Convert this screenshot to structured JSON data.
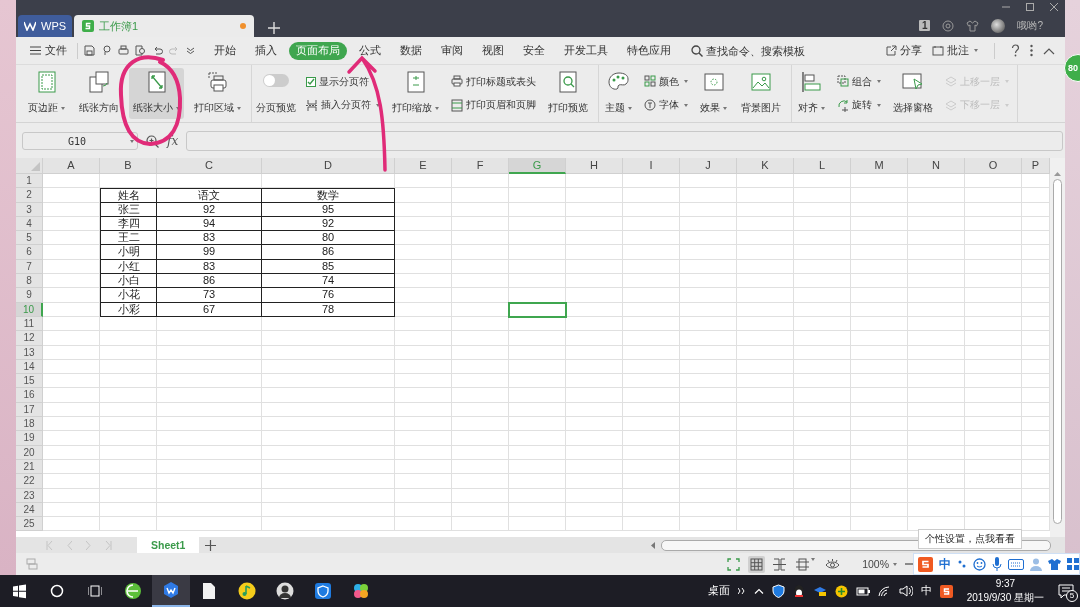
{
  "title_bar": {
    "tabs": [
      {
        "kind": "home",
        "label": "WPS",
        "selected": false
      },
      {
        "kind": "document",
        "label": "工作簿1",
        "selected": true,
        "unsaved": true
      }
    ],
    "account_badge": "1",
    "user_name": "哦哟?"
  },
  "menu": {
    "file": "文件",
    "tabs": [
      {
        "label": "开始",
        "selected": false
      },
      {
        "label": "插入",
        "selected": false
      },
      {
        "label": "页面布局",
        "selected": true
      },
      {
        "label": "公式",
        "selected": false
      },
      {
        "label": "数据",
        "selected": false
      },
      {
        "label": "审阅",
        "selected": false
      },
      {
        "label": "视图",
        "selected": false
      },
      {
        "label": "安全",
        "selected": false
      },
      {
        "label": "开发工具",
        "selected": false
      },
      {
        "label": "特色应用",
        "selected": false
      }
    ],
    "search_placeholder": "查找命令、搜索模板",
    "share": "分享",
    "comment": "批注"
  },
  "ribbon": [
    {
      "items": [
        {
          "kind": "large",
          "label": "页边距",
          "dropdown": true,
          "highlighted": false
        },
        {
          "kind": "large",
          "label": "纸张方向",
          "dropdown": false,
          "highlighted": false
        },
        {
          "kind": "large",
          "label": "纸张大小",
          "dropdown": true,
          "highlighted": true
        },
        {
          "kind": "large",
          "label": "打印区域",
          "dropdown": true,
          "highlighted": false
        }
      ]
    },
    {
      "items": [
        {
          "kind": "switch",
          "label": "分页预览",
          "on": false
        },
        {
          "kind": "stack",
          "items": [
            {
              "kind": "checkbox",
              "label": "显示分页符",
              "checked": true
            },
            {
              "kind": "small",
              "label": "插入分页符",
              "dropdown": true,
              "disabled": false
            }
          ]
        },
        {
          "kind": "large",
          "label": "打印缩放",
          "dropdown": true,
          "highlighted": false
        },
        {
          "kind": "stack",
          "items": [
            {
              "kind": "small",
              "label": "打印标题或表头",
              "dropdown": false,
              "disabled": false
            },
            {
              "kind": "small",
              "label": "打印页眉和页脚",
              "dropdown": false,
              "disabled": false
            }
          ]
        },
        {
          "kind": "large",
          "label": "打印预览",
          "dropdown": false,
          "highlighted": false
        }
      ]
    },
    {
      "items": [
        {
          "kind": "large",
          "label": "主题",
          "dropdown": true,
          "highlighted": false
        },
        {
          "kind": "stack",
          "items": [
            {
              "kind": "small",
              "label": "颜色",
              "dropdown": true,
              "disabled": false
            },
            {
              "kind": "small",
              "label": "字体",
              "dropdown": true,
              "disabled": false
            }
          ]
        },
        {
          "kind": "large",
          "label": "效果",
          "dropdown": true,
          "highlighted": false
        },
        {
          "kind": "large",
          "label": "背景图片",
          "dropdown": false,
          "highlighted": false
        }
      ]
    },
    {
      "items": [
        {
          "kind": "large",
          "label": "对齐",
          "dropdown": true,
          "highlighted": false
        },
        {
          "kind": "stack",
          "items": [
            {
              "kind": "small",
              "label": "组合",
              "dropdown": true,
              "disabled": false
            },
            {
              "kind": "small",
              "label": "旋转",
              "dropdown": true,
              "disabled": false
            }
          ]
        },
        {
          "kind": "large",
          "label": "选择窗格",
          "dropdown": false,
          "highlighted": false
        },
        {
          "kind": "stack",
          "items": [
            {
              "kind": "small",
              "label": "上移一层",
              "dropdown": true,
              "disabled": true
            },
            {
              "kind": "small",
              "label": "下移一层",
              "dropdown": true,
              "disabled": true
            }
          ]
        }
      ]
    }
  ],
  "formula_bar": {
    "name_box": "G10",
    "fx": "fx"
  },
  "sheet": {
    "columns": [
      {
        "label": "A",
        "selected": false
      },
      {
        "label": "B",
        "selected": false
      },
      {
        "label": "C",
        "selected": false
      },
      {
        "label": "D",
        "selected": false
      },
      {
        "label": "E",
        "selected": false
      },
      {
        "label": "F",
        "selected": false
      },
      {
        "label": "G",
        "selected": true
      },
      {
        "label": "H",
        "selected": false
      },
      {
        "label": "I",
        "selected": false
      },
      {
        "label": "J",
        "selected": false
      },
      {
        "label": "K",
        "selected": false
      },
      {
        "label": "L",
        "selected": false
      },
      {
        "label": "M",
        "selected": false
      },
      {
        "label": "N",
        "selected": false
      },
      {
        "label": "O",
        "selected": false
      },
      {
        "label": "P",
        "selected": false
      }
    ],
    "rows": [
      {
        "label": "1",
        "selected": false
      },
      {
        "label": "2",
        "selected": false
      },
      {
        "label": "3",
        "selected": false
      },
      {
        "label": "4",
        "selected": false
      },
      {
        "label": "5",
        "selected": false
      },
      {
        "label": "6",
        "selected": false
      },
      {
        "label": "7",
        "selected": false
      },
      {
        "label": "8",
        "selected": false
      },
      {
        "label": "9",
        "selected": false
      },
      {
        "label": "10",
        "selected": true
      },
      {
        "label": "11",
        "selected": false
      },
      {
        "label": "12",
        "selected": false
      },
      {
        "label": "13",
        "selected": false
      },
      {
        "label": "14",
        "selected": false
      },
      {
        "label": "15",
        "selected": false
      },
      {
        "label": "16",
        "selected": false
      },
      {
        "label": "17",
        "selected": false
      },
      {
        "label": "18",
        "selected": false
      },
      {
        "label": "19",
        "selected": false
      },
      {
        "label": "20",
        "selected": false
      },
      {
        "label": "21",
        "selected": false
      },
      {
        "label": "22",
        "selected": false
      },
      {
        "label": "23",
        "selected": false
      },
      {
        "label": "24",
        "selected": false
      },
      {
        "label": "25",
        "selected": false
      }
    ],
    "table": {
      "header": [
        "姓名",
        "语文",
        "数学"
      ],
      "rows": [
        [
          "张三",
          "92",
          "95"
        ],
        [
          "李四",
          "94",
          "92"
        ],
        [
          "王二",
          "83",
          "80"
        ],
        [
          "小明",
          "99",
          "86"
        ],
        [
          "小红",
          "83",
          "85"
        ],
        [
          "小白",
          "86",
          "74"
        ],
        [
          "小花",
          "73",
          "76"
        ],
        [
          "小彩",
          "67",
          "78"
        ]
      ]
    }
  },
  "sheet_tabs": [
    {
      "label": "Sheet1",
      "selected": true
    }
  ],
  "status_bar": {
    "zoom": "100%"
  },
  "ime_tooltip": "个性设置，点我看看",
  "ime_bar": {
    "mode": "中"
  },
  "side_badge": "80",
  "taskbar": {
    "desktop_label": "桌面",
    "ime": "中",
    "time": "9:37",
    "date": "2019/9/30 星期一",
    "notifications": "5"
  }
}
